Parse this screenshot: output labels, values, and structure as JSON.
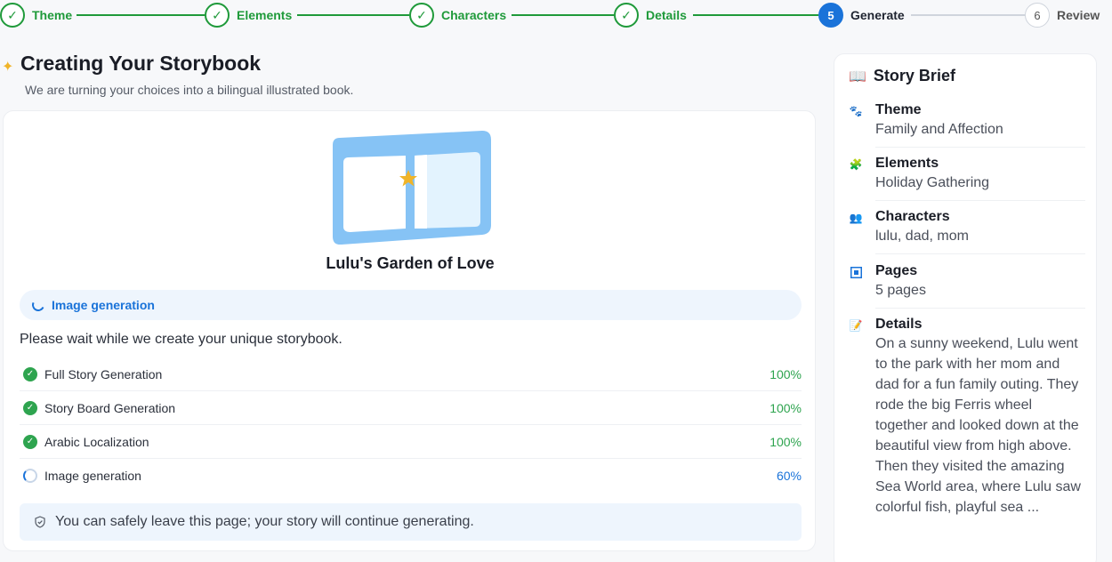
{
  "stepper": {
    "steps": [
      {
        "number": "✓",
        "label": "Theme",
        "state": "done"
      },
      {
        "number": "✓",
        "label": "Elements",
        "state": "done"
      },
      {
        "number": "✓",
        "label": "Characters",
        "state": "done"
      },
      {
        "number": "✓",
        "label": "Details",
        "state": "done"
      },
      {
        "number": "5",
        "label": "Generate",
        "state": "active"
      },
      {
        "number": "6",
        "label": "Review",
        "state": "todo"
      }
    ]
  },
  "header": {
    "title": "Creating Your Storybook",
    "subtitle": "We are turning your choices into a bilingual illustrated book."
  },
  "main": {
    "book_title": "Lulu's Garden of Love",
    "phase_label": "Image generation",
    "wait_text": "Please wait while we create your unique storybook.",
    "tasks": [
      {
        "label": "Full Story Generation",
        "percent": "100%",
        "status": "done"
      },
      {
        "label": "Story Board Generation",
        "percent": "100%",
        "status": "done"
      },
      {
        "label": "Arabic Localization",
        "percent": "100%",
        "status": "done"
      },
      {
        "label": "Image generation",
        "percent": "60%",
        "status": "running"
      }
    ],
    "notice": "You can safely leave this page; your story will continue generating."
  },
  "brief": {
    "title": "Story Brief",
    "items": [
      {
        "label": "Theme",
        "value": "Family and Affection",
        "icon": "paw-icon"
      },
      {
        "label": "Elements",
        "value": "Holiday Gathering",
        "icon": "puzzle-icon"
      },
      {
        "label": "Characters",
        "value": "lulu, dad, mom",
        "icon": "people-icon"
      },
      {
        "label": "Pages",
        "value": "5 pages",
        "icon": "pages-icon"
      },
      {
        "label": "Details",
        "value": "On a sunny weekend, Lulu went to the park with her mom and dad for a fun family outing. They rode the big Ferris wheel together and looked down at the beautiful view from high above. Then they visited the amazing Sea World area, where Lulu saw colorful fish, playful sea ...",
        "icon": "memo-icon"
      }
    ]
  },
  "colors": {
    "done_green": "#1f9a3a",
    "accent_blue": "#1a73d9",
    "book_blue": "#86c3f5",
    "star": "#f0b429"
  }
}
